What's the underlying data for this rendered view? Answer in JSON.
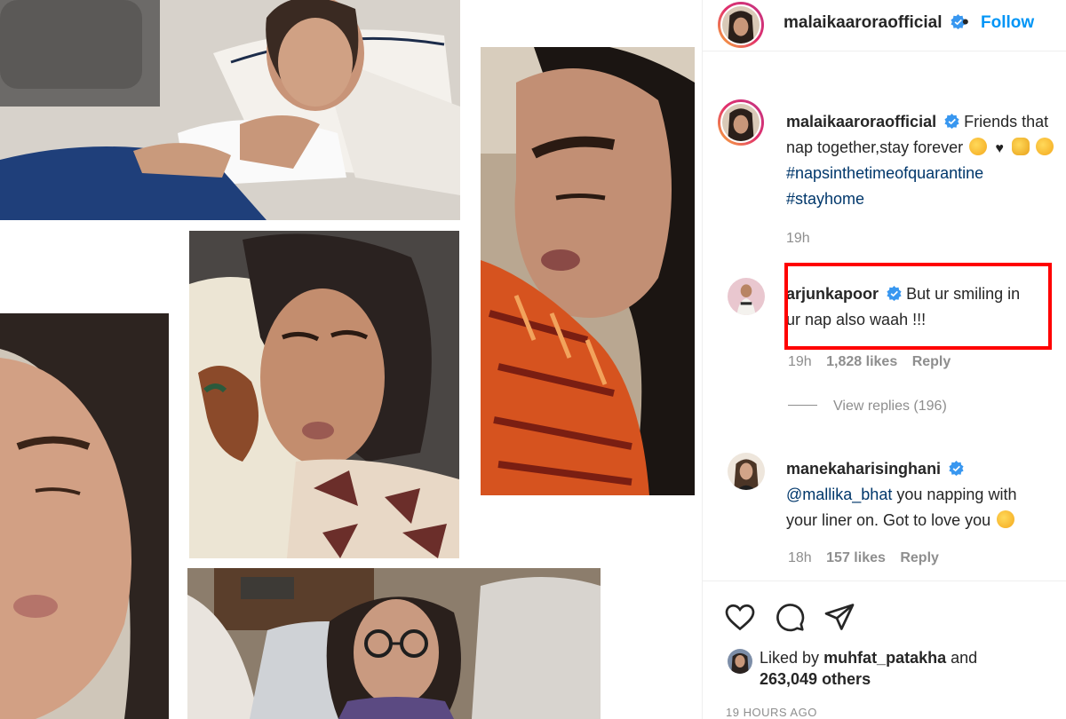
{
  "post": {
    "author": "malaikaaroraofficial",
    "follow_label": "Follow",
    "dot": "•"
  },
  "caption": {
    "username": "malaikaaroraofficial",
    "text_line1": "Friends that",
    "text_line2": "nap together,stay forever",
    "hashtag1": "#napsinthetimeofquarantine",
    "hashtag2": "#stayhome",
    "time": "19h"
  },
  "comments": [
    {
      "username": "arjunkapoor",
      "text_line1": "But ur smiling in",
      "text_line2": "ur nap also waah !!!",
      "time": "19h",
      "likes": "1,828 likes",
      "reply_label": "Reply"
    },
    {
      "username": "manekaharisinghani",
      "mention": "@mallika_bhat",
      "text_line1": "you napping with",
      "text_line2": "your liner on. Got to love you",
      "time": "18h",
      "likes": "157 likes",
      "reply_label": "Reply"
    }
  ],
  "view_replies": "View replies (196)",
  "liked_by": {
    "prefix": "Liked by",
    "user": "muhfat_patakha",
    "and": "and",
    "count": "263,049 others"
  },
  "post_time": "19 HOURS AGO",
  "icons": [
    "heart-icon",
    "comment-icon",
    "share-icon",
    "verified-icon"
  ],
  "colors": {
    "link_blue": "#0095f6",
    "hashtag": "#00376b",
    "muted": "#8e8e8e",
    "highlight": "#ff0000"
  }
}
